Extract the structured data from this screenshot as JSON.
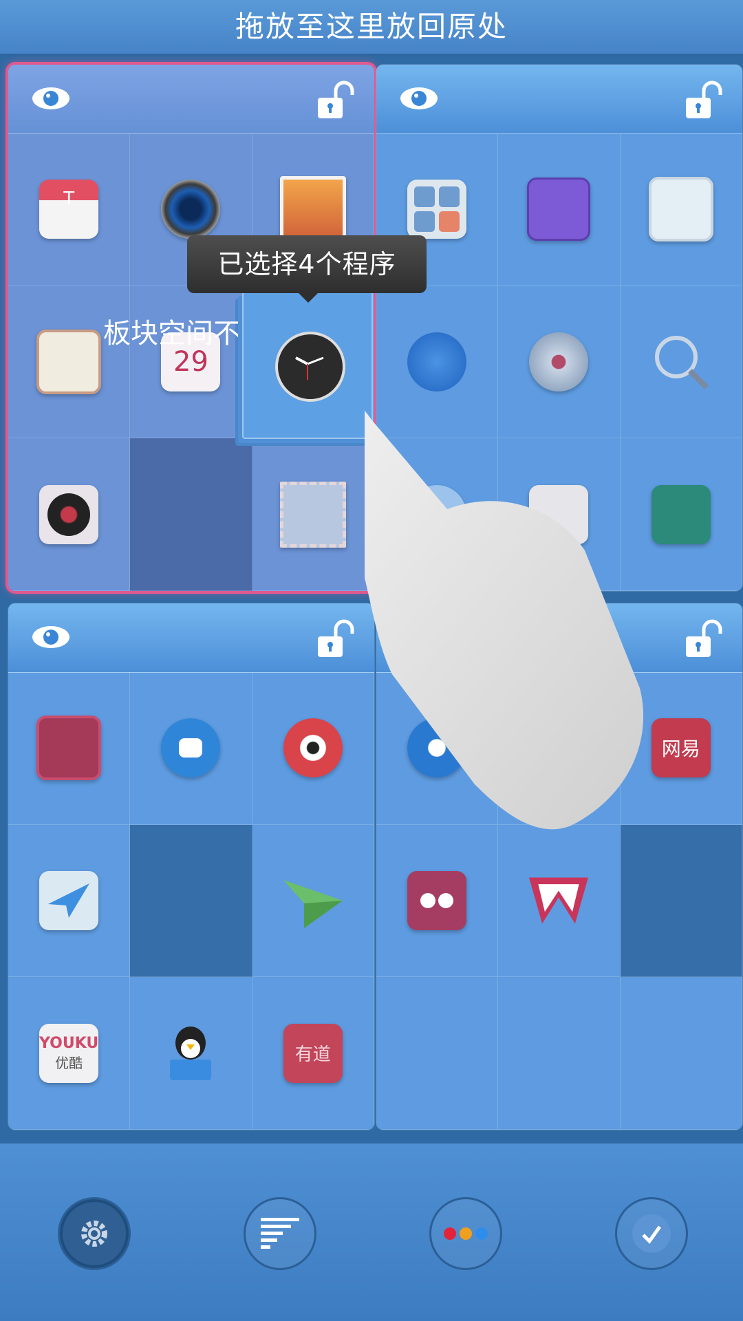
{
  "top_bar": {
    "drop_hint": "拖放至这里放回原处"
  },
  "toast": {
    "text": "已选择4个程序"
  },
  "hint": {
    "text": "板块空间不"
  },
  "panels": [
    {
      "name": "top-left",
      "selected": true,
      "icons": [
        "store-icon",
        "camera-icon",
        "photos-icon",
        "notes-icon",
        "calendar-icon",
        "clock-icon",
        "record-player-icon",
        "",
        "stamp-icon"
      ],
      "calendar_date": "29"
    },
    {
      "name": "top-right",
      "selected": false,
      "icons": [
        "calculator-icon",
        "game-console-icon",
        "weather-icon",
        "umbrella-icon",
        "music-disc-icon",
        "magnifier-icon",
        "app-icon",
        "app-icon",
        "phone-manual-icon"
      ]
    },
    {
      "name": "bottom-left",
      "selected": false,
      "icons": [
        "red-app-icon",
        "chat-bubble-icon",
        "weibo-icon",
        "maps-icon",
        "",
        "paper-plane-icon",
        "youku-icon",
        "qq-icon",
        "youdao-icon"
      ],
      "youku_label": "YOUKU",
      "youku_sub": "优酷",
      "youdao_label": "有道"
    },
    {
      "name": "bottom-right",
      "selected": false,
      "icons": [
        "browser-icon",
        "app-icon",
        "netease-icon",
        "quote-icon",
        "wps-icon",
        "",
        "",
        "",
        ""
      ],
      "netease_label": "网易"
    }
  ],
  "bottom_bar": {
    "buttons": [
      "settings-button",
      "sort-button",
      "more-button",
      "done-button"
    ]
  },
  "colors": {
    "selection": "#e0598f",
    "background": "#3f7fc4"
  }
}
